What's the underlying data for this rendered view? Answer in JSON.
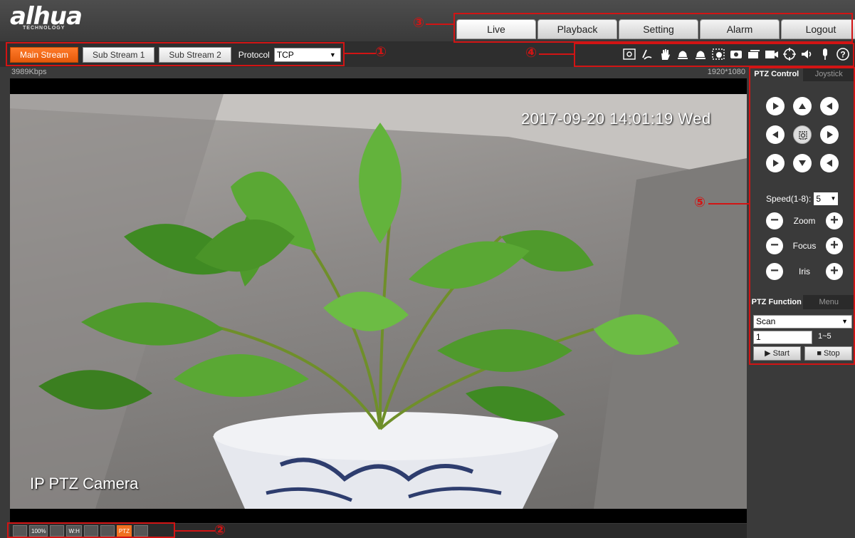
{
  "logo": {
    "brand": "alhua",
    "tagline": "TECHNOLOGY"
  },
  "nav": {
    "tabs": [
      {
        "label": "Live"
      },
      {
        "label": "Playback"
      },
      {
        "label": "Setting"
      },
      {
        "label": "Alarm"
      },
      {
        "label": "Logout"
      }
    ]
  },
  "stream": {
    "buttons": [
      {
        "label": "Main Stream"
      },
      {
        "label": "Sub Stream 1"
      },
      {
        "label": "Sub Stream 2"
      }
    ],
    "protocol_label": "Protocol",
    "protocol_value": "TCP"
  },
  "toolbar_icons": [
    "region-focus-icon",
    "draw-icon",
    "hand-icon",
    "bell-icon",
    "alarm-icon",
    "zoom-region-icon",
    "snapshot-icon",
    "triple-snapshot-icon",
    "record-icon",
    "crosshair-icon",
    "speaker-icon",
    "microphone-icon",
    "help-icon"
  ],
  "video": {
    "bitrate": "3989Kbps",
    "resolution": "1920*1080",
    "osd_time": "2017-09-20 14:01:19 Wed",
    "osd_title": "IP PTZ Camera"
  },
  "bottom": {
    "icons": [
      {
        "name": "fit-icon",
        "label": ""
      },
      {
        "name": "zoom-100-icon",
        "label": "100%"
      },
      {
        "name": "fullscreen-icon",
        "label": ""
      },
      {
        "name": "aspect-ratio-icon",
        "label": "W:H"
      },
      {
        "name": "fluency-icon",
        "label": ""
      },
      {
        "name": "rules-icon",
        "label": ""
      },
      {
        "name": "ptz-icon",
        "label": "PTZ"
      },
      {
        "name": "location-icon",
        "label": ""
      }
    ]
  },
  "ptz": {
    "tabs": [
      {
        "label": "PTZ Control"
      },
      {
        "label": "Joystick"
      }
    ],
    "speed_label": "Speed(1-8):",
    "speed_value": "5",
    "zoom_label": "Zoom",
    "focus_label": "Focus",
    "iris_label": "Iris",
    "function_tabs": [
      {
        "label": "PTZ Function"
      },
      {
        "label": "Menu"
      }
    ],
    "function_value": "Scan",
    "range_value": "1",
    "range_label": "1~5",
    "start_label": "▶ Start",
    "stop_label": "■ Stop"
  },
  "annotations": [
    "①",
    "②",
    "③",
    "④",
    "⑤"
  ],
  "colors": {
    "accent": "#f07020",
    "annotation": "#d21414",
    "header": "#3a3a3a"
  }
}
